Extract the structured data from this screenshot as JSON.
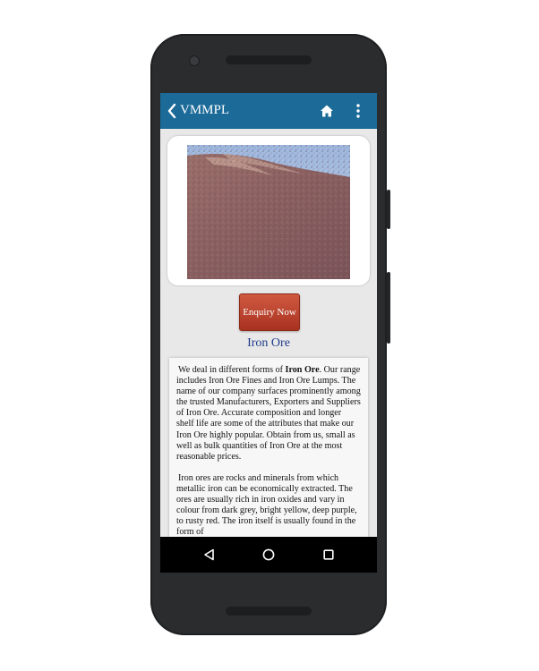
{
  "appbar": {
    "title": "VMMPL",
    "back_icon": "chevron-left-icon",
    "home_icon": "home-icon",
    "menu_icon": "more-vert-icon",
    "color": "#1b6a98"
  },
  "product": {
    "image_alt": "iron ore stockpile photo",
    "enquiry_label": "Enquiry Now",
    "title": "Iron Ore",
    "enquiry_color": "#b8412a",
    "title_color": "#1f3a8a"
  },
  "description": {
    "p1_lead": "We deal in different forms of ",
    "p1_bold": "Iron Ore",
    "p1_rest": ". Our range includes Iron Ore Fines and Iron Ore Lumps. The name of our company surfaces prominently among the trusted Manufacturers, Exporters and Suppliers of Iron Ore. Accurate composition and longer shelf life are some of the attributes that make our Iron Ore highly popular. Obtain from us, small as well as bulk quantities of Iron Ore at the most reasonable prices.",
    "p2": "Iron ores are rocks and minerals from which metallic iron can be economically extracted. The ores are usually rich in iron oxides and vary in colour from dark grey, bright yellow, deep purple, to rusty red. The iron itself is usually found in the form of"
  },
  "navbar": {
    "back_icon": "triangle-back-icon",
    "home_icon": "circle-home-icon",
    "recent_icon": "square-recents-icon"
  }
}
